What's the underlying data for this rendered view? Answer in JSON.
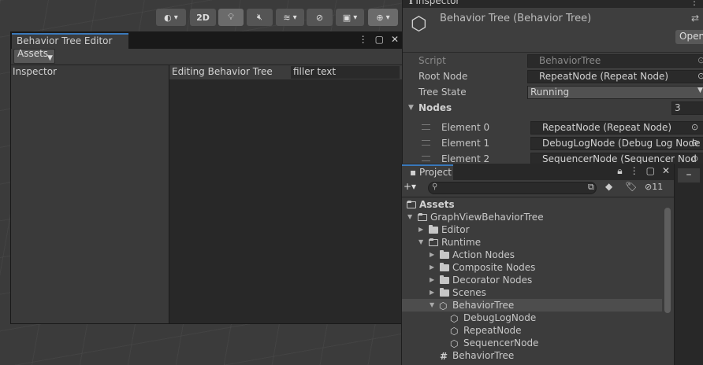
{
  "scene_toolbar": {
    "btn_2d": "2D"
  },
  "behavior_tree_editor": {
    "tab_title": "Behavior Tree Editor",
    "assets_button": "Assets",
    "inspector_label": "Inspector",
    "editing_label": "Editing Behavior Tree",
    "filler_text": "filler text"
  },
  "inspector": {
    "tab_title": "Inspector",
    "title": "Behavior Tree (Behavior Tree)",
    "open_button": "Open",
    "properties": [
      {
        "label": "Script",
        "value": "BehaviorTree"
      },
      {
        "label": "Root Node",
        "value": "RepeatNode (Repeat Node)"
      },
      {
        "label": "Tree State",
        "value": "Running"
      }
    ],
    "nodes_label": "Nodes",
    "nodes_count": "3",
    "elements": [
      {
        "label": "Element 0",
        "value": "RepeatNode (Repeat Node)"
      },
      {
        "label": "Element 1",
        "value": "DebugLogNode (Debug Log Node"
      },
      {
        "label": "Element 2",
        "value": "SequencerNode (Sequencer Nod"
      }
    ]
  },
  "project": {
    "tab_title": "Project",
    "hidden_count": "11",
    "tree": [
      {
        "label": "Assets"
      },
      {
        "label": "GraphViewBehaviorTree"
      },
      {
        "label": "Editor"
      },
      {
        "label": "Runtime"
      },
      {
        "label": "Action Nodes"
      },
      {
        "label": "Composite Nodes"
      },
      {
        "label": "Decorator Nodes"
      },
      {
        "label": "Scenes"
      },
      {
        "label": "BehaviorTree"
      },
      {
        "label": "DebugLogNode"
      },
      {
        "label": "RepeatNode"
      },
      {
        "label": "SequencerNode"
      },
      {
        "label": "BehaviorTree"
      }
    ]
  },
  "right_strip": {
    "minus": "–"
  }
}
